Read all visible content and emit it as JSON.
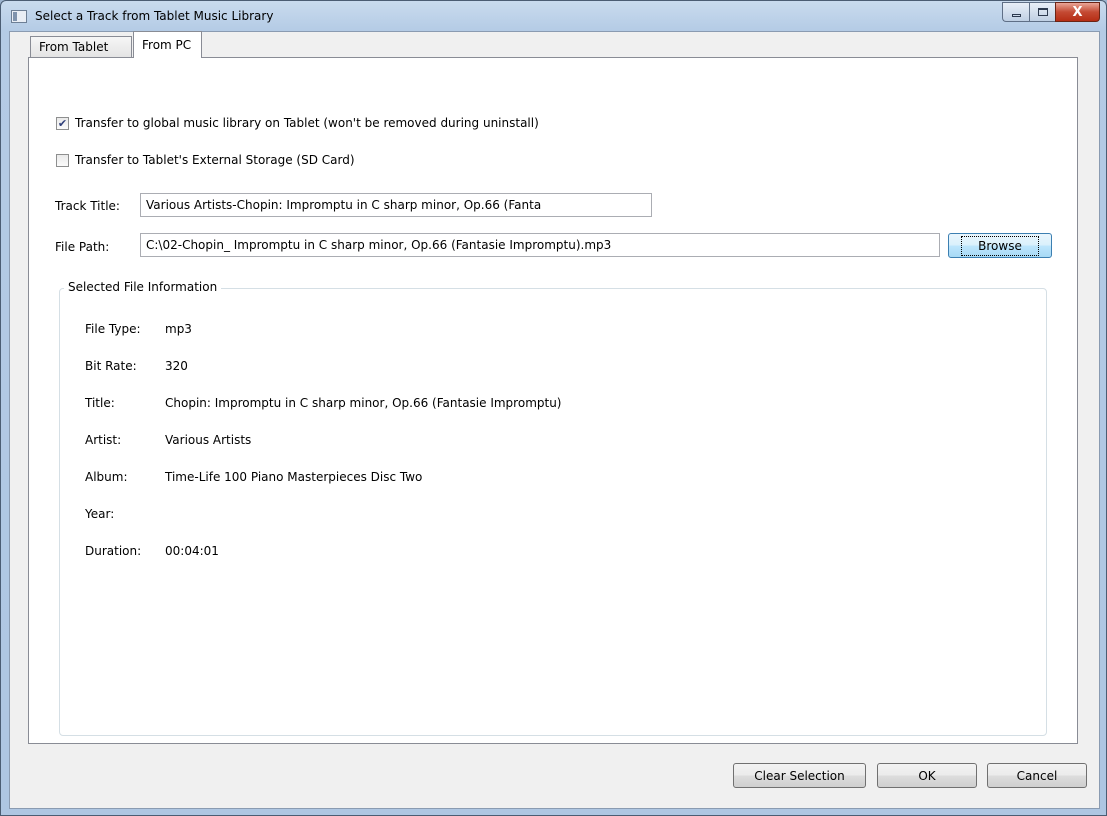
{
  "window": {
    "title": "Select a Track from Tablet Music Library",
    "close_glyph": "X"
  },
  "tabs": [
    {
      "label": "From Tablet",
      "selected": false
    },
    {
      "label": "From PC",
      "selected": true
    }
  ],
  "options": {
    "global_library": {
      "label": "Transfer to global music library on Tablet (won't be removed during uninstall)",
      "checked": true,
      "mark": "✔"
    },
    "external_storage": {
      "label": "Transfer to Tablet's External Storage (SD Card)",
      "checked": false
    }
  },
  "fields": {
    "track_title": {
      "label": "Track Title:",
      "value": "Various Artists-Chopin: Impromptu in C sharp minor, Op.66 (Fanta"
    },
    "file_path": {
      "label": "File Path:",
      "value": "C:\\02-Chopin_ Impromptu in C sharp minor, Op.66 (Fantasie Impromptu).mp3"
    },
    "browse_label": "Browse"
  },
  "file_info": {
    "group_title": "Selected File Information",
    "rows": [
      {
        "label": "File Type:",
        "value": "mp3"
      },
      {
        "label": "Bit Rate:",
        "value": "320"
      },
      {
        "label": "Title:",
        "value": "Chopin: Impromptu in C sharp minor, Op.66 (Fantasie Impromptu)"
      },
      {
        "label": "Artist:",
        "value": "Various Artists"
      },
      {
        "label": "Album:",
        "value": "Time-Life 100 Piano Masterpieces Disc Two"
      },
      {
        "label": "Year:",
        "value": ""
      },
      {
        "label": "Duration:",
        "value": "00:04:01"
      }
    ]
  },
  "footer": {
    "clear_label": "Clear Selection",
    "ok_label": "OK",
    "cancel_label": "Cancel"
  }
}
